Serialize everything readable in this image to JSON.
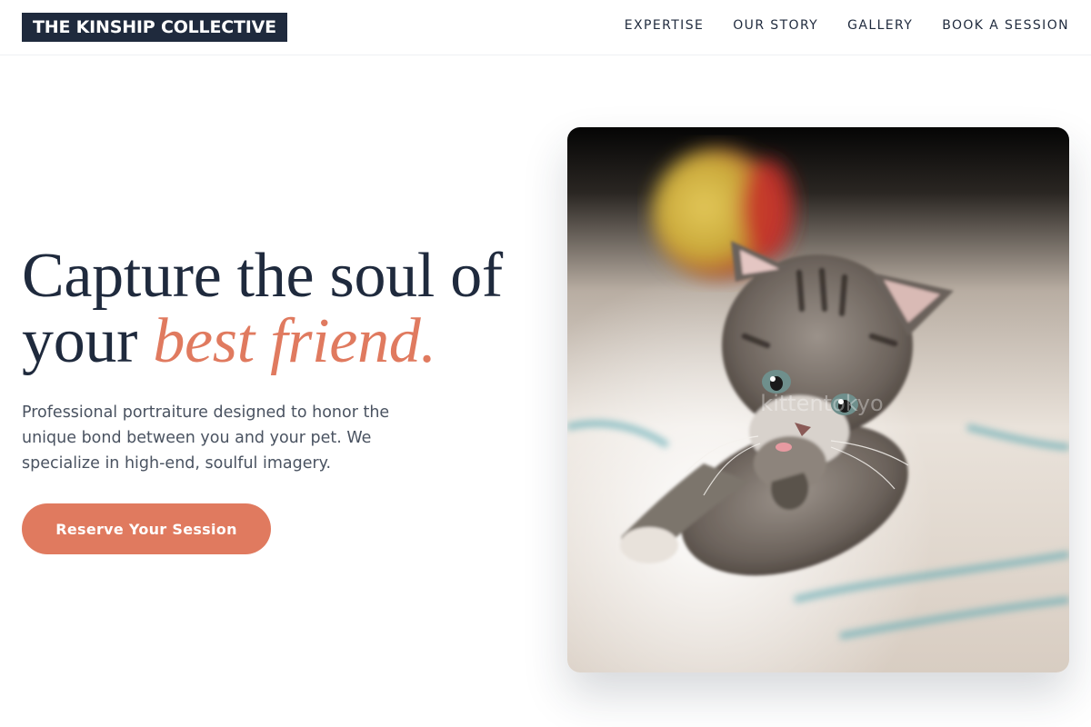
{
  "brand": {
    "name": "THE KINSHIP COLLECTIVE"
  },
  "nav": {
    "links": [
      {
        "label": "EXPERTISE"
      },
      {
        "label": "OUR STORY"
      },
      {
        "label": "GALLERY"
      },
      {
        "label": "BOOK A SESSION"
      }
    ]
  },
  "hero": {
    "headline_line1": "Capture the soul of",
    "headline_line2_plain": "your ",
    "headline_line2_accent": "best friend.",
    "subtext": "Professional portraiture designed to honor the unique bond between you and your pet. We specialize in high-end, soulful imagery.",
    "cta_label": "Reserve Your Session",
    "image_subject": "kitten-photo",
    "image_watermark": "kittentokyo"
  },
  "colors": {
    "navy": "#1f2a3d",
    "accent": "#e07a5f",
    "body_text": "#4a5361"
  }
}
